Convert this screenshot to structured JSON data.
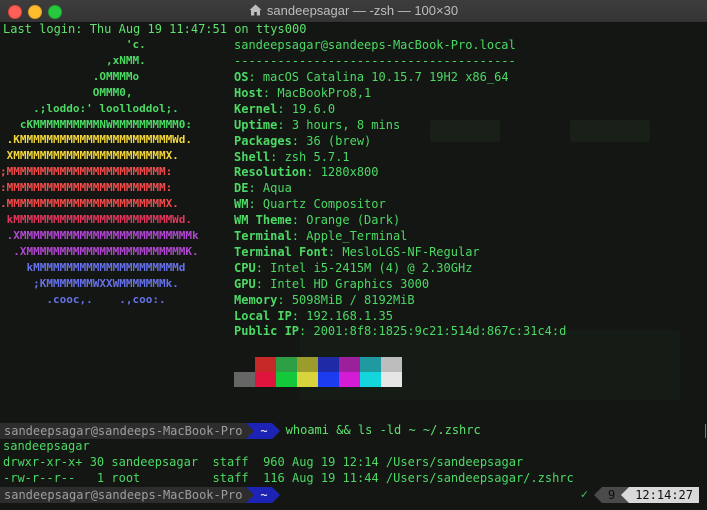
{
  "window": {
    "title": "sandeepsagar — -zsh — 100×30"
  },
  "colors": {
    "terminal_bg": "#131613",
    "terminal_text": "#5ee36e",
    "prompt_dir_bg": "#1d24b5",
    "prompt_user_bg": "#2d2d2d"
  },
  "terminal": {
    "last_login": "Last login: Thu Aug 19 11:47:51 on ttys000",
    "logo_lines": [
      {
        "text": "                   'c.",
        "color": "#4cd964"
      },
      {
        "text": "                ,xNMM.",
        "color": "#4cd964"
      },
      {
        "text": "              .OMMMMo",
        "color": "#4cd964"
      },
      {
        "text": "              OMMM0,",
        "color": "#4cd964"
      },
      {
        "text": "     .;loddo:' loolloddol;.",
        "color": "#4cd964"
      },
      {
        "text": "   cKMMMMMMMMMMNWMMMMMMMMMM0:",
        "color": "#4cd964"
      },
      {
        "text": " .KMMMMMMMMMMMMMMMMMMMMMMMWd.",
        "color": "#f2d63c"
      },
      {
        "text": " XMMMMMMMMMMMMMMMMMMMMMMMX.",
        "color": "#f2d63c"
      },
      {
        "text": ";MMMMMMMMMMMMMMMMMMMMMMMM:",
        "color": "#f24d4d"
      },
      {
        "text": ":MMMMMMMMMMMMMMMMMMMMMMMM:",
        "color": "#f24d4d"
      },
      {
        "text": ".MMMMMMMMMMMMMMMMMMMMMMMMX.",
        "color": "#f24d4d"
      },
      {
        "text": " kMMMMMMMMMMMMMMMMMMMMMMMMWd.",
        "color": "#e2375d"
      },
      {
        "text": " .XMMMMMMMMMMMMMMMMMMMMMMMMMMk",
        "color": "#b148d2"
      },
      {
        "text": "  .XMMMMMMMMMMMMMMMMMMMMMMMMK.",
        "color": "#b148d2"
      },
      {
        "text": "    kMMMMMMMMMMMMMMMMMMMMMMd",
        "color": "#6672e8"
      },
      {
        "text": "     ;KMMMMMMMWXXWMMMMMMMk.",
        "color": "#6672e8"
      },
      {
        "text": "       .cooc,.    .,coo:.",
        "color": "#6672e8"
      }
    ],
    "userhost": "sandeepsagar@sandeeps-MacBook-Pro.local",
    "separator": "---------------------------------------",
    "info": [
      {
        "label": "OS",
        "value": "macOS Catalina 10.15.7 19H2 x86_64"
      },
      {
        "label": "Host",
        "value": "MacBookPro8,1"
      },
      {
        "label": "Kernel",
        "value": "19.6.0"
      },
      {
        "label": "Uptime",
        "value": "3 hours, 8 mins"
      },
      {
        "label": "Packages",
        "value": "36 (brew)"
      },
      {
        "label": "Shell",
        "value": "zsh 5.7.1"
      },
      {
        "label": "Resolution",
        "value": "1280x800"
      },
      {
        "label": "DE",
        "value": "Aqua"
      },
      {
        "label": "WM",
        "value": "Quartz Compositor"
      },
      {
        "label": "WM Theme",
        "value": "Orange (Dark)"
      },
      {
        "label": "Terminal",
        "value": "Apple_Terminal"
      },
      {
        "label": "Terminal Font",
        "value": "MesloLGS-NF-Regular"
      },
      {
        "label": "CPU",
        "value": "Intel i5-2415M (4) @ 2.30GHz"
      },
      {
        "label": "GPU",
        "value": "Intel HD Graphics 3000"
      },
      {
        "label": "Memory",
        "value": "5098MiB / 8192MiB"
      },
      {
        "label": "Local IP",
        "value": "192.168.1.35"
      },
      {
        "label": "Public IP",
        "value": "2001:8f8:1825:9c21:514d:867c:31c4:d"
      }
    ],
    "palette_row1": [
      "#131613",
      "#c62828",
      "#2e9e44",
      "#9c9c2c",
      "#1f2ba6",
      "#9c1f9c",
      "#1e9aa0",
      "#bdbdbd"
    ],
    "palette_row2": [
      "#666666",
      "#e0143c",
      "#14c83c",
      "#d8d43c",
      "#1c3cf0",
      "#d41cd4",
      "#14d4dc",
      "#e6e6e6"
    ],
    "prompt1": {
      "user": "sandeepsagar@sandeeps-MacBook-Pro",
      "dir": "~",
      "command": "whoami && ls -ld ~ ~/.zshrc"
    },
    "output": [
      "sandeepsagar",
      "drwxr-xr-x+ 30 sandeepsagar  staff  960 Aug 19 12:14 /Users/sandeepsagar",
      "-rw-r--r--   1 root          staff  116 Aug 19 11:44 /Users/sandeepsagar/.zshrc"
    ],
    "prompt2": {
      "user": "sandeepsagar@sandeeps-MacBook-Pro",
      "dir": "~",
      "check": "✓",
      "num": "9",
      "time": "12:14:27"
    }
  }
}
